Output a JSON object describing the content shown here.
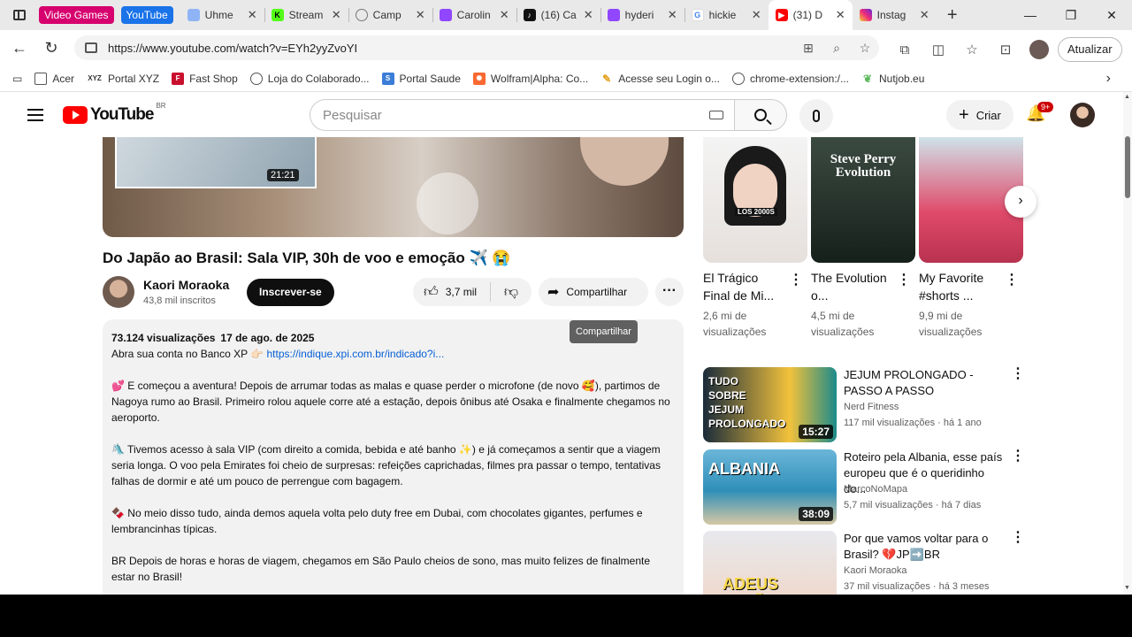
{
  "browser": {
    "tab_groups": [
      {
        "label": "Video Games",
        "color": "#d6006e"
      },
      {
        "label": "YouTube",
        "color": "#1a73e8"
      }
    ],
    "tabs": [
      {
        "label": "Uhme",
        "icon": "chat-icon",
        "color": "#8fb4f5"
      },
      {
        "label": "Stream",
        "icon": "kick-icon",
        "color": "#53fc18"
      },
      {
        "label": "Camp",
        "icon": "globe-icon",
        "color": "#999999"
      },
      {
        "label": "Carolin",
        "icon": "twitch-icon",
        "color": "#9146ff"
      },
      {
        "label": "(16) Ca",
        "icon": "tiktok-icon",
        "color": "#111111"
      },
      {
        "label": "hyderi",
        "icon": "twitch-icon",
        "color": "#9146ff"
      },
      {
        "label": "hickie",
        "icon": "google-icon",
        "color": "#4285f4"
      },
      {
        "label": "(31) D",
        "icon": "youtube-icon",
        "color": "#ff0000",
        "active": true
      },
      {
        "label": "Instag",
        "icon": "instagram-icon",
        "color": "#e1306c"
      }
    ],
    "url": "https://www.youtube.com/watch?v=EYh2yyZvoYI",
    "update_label": "Atualizar",
    "bookmarks": [
      {
        "label": "Acer",
        "icon": "folder-icon"
      },
      {
        "label": "Portal XYZ",
        "icon": "xyz-icon"
      },
      {
        "label": "Fast Shop",
        "icon": "fastshop-icon"
      },
      {
        "label": "Loja do Colaborado...",
        "icon": "globe-icon"
      },
      {
        "label": "Portal Saude",
        "icon": "portal-icon"
      },
      {
        "label": "Wolfram|Alpha: Co...",
        "icon": "wolfram-icon"
      },
      {
        "label": "Acesse seu Login o...",
        "icon": "pen-icon"
      },
      {
        "label": "chrome-extension:/...",
        "icon": "globe-icon"
      },
      {
        "label": "Nutjob.eu",
        "icon": "leaf-icon"
      }
    ]
  },
  "youtube": {
    "logo_text": "YouTube",
    "country_code": "BR",
    "search_placeholder": "Pesquisar",
    "create_label": "Criar",
    "notif_badge": "9+"
  },
  "video": {
    "duration_inset": "21:21",
    "title": "Do Japão ao Brasil: Sala VIP, 30h de voo e emoção ✈️ 😭",
    "channel": "Kaori Moraoka",
    "subscribers": "43,8 mil inscritos",
    "subscribe_label": "Inscrever-se",
    "likes": "3,7 mil",
    "share_label": "Compartilhar",
    "tooltip": "Compartilhar",
    "views": "73.124 visualizações",
    "date": "17 de ago. de 2025",
    "description": [
      {
        "text": "Abra sua conta no Banco XP  👉🏻 ",
        "link": "https://indique.xpi.com.br/indicado?i..."
      },
      {
        "text": "💕 E começou a aventura! Depois de arrumar todas as malas e quase perder o microfone (de novo 🥰), partimos de Nagoya rumo ao Brasil. Primeiro rolou aquele corre até a estação, depois ônibus até Osaka e finalmente chegamos no aeroporto."
      },
      {
        "text": "🛝 Tivemos acesso à sala VIP (com direito a comida, bebida e até banho ✨) e já começamos a sentir que a viagem seria longa. O voo pela Emirates foi cheio de surpresas: refeições caprichadas, filmes pra passar o tempo, tentativas falhas de dormir e até um pouco de perrengue com bagagem."
      },
      {
        "text": "🍫 No meio disso tudo, ainda demos aquela volta pelo duty free em Dubai, com chocolates gigantes, perfumes e lembrancinhas típicas."
      },
      {
        "text": "BR Depois de horas e horas de viagem, chegamos em São Paulo cheios de sono, mas muito felizes de finalmente estar no Brasil!"
      }
    ]
  },
  "shorts": [
    {
      "title": "El Trágico Final de Mi...",
      "views": "2,6 mi de visualizações",
      "thumb_text": "LOS 2000S"
    },
    {
      "title": "The Evolution o...",
      "views": "4,5 mi de visualizações",
      "thumb_text": "Steve Perry Evolution"
    },
    {
      "title": "My Favorite #shorts ...",
      "views": "9,9 mi de visualizações",
      "thumb_text": ""
    }
  ],
  "recommendations": [
    {
      "title": "JEJUM PROLONGADO - PASSO A PASSO",
      "channel": "Nerd Fitness",
      "meta": "117 mil visualizações · há 1 ano",
      "duration": "15:27",
      "thumb_text": "TUDO SOBRE JEJUM PROLONGADO"
    },
    {
      "title": "Roteiro pela Albania, esse país europeu que é o queridinho do...",
      "channel": "MarcoNoMapa",
      "meta": "5,7 mil visualizações · há 7 dias",
      "duration": "38:09",
      "thumb_text": "ALBANIA"
    },
    {
      "title": "Por que vamos voltar para o Brasil? 💔JP➡️BR",
      "channel": "Kaori Moraoka",
      "meta": "37 mil visualizações · há 3 meses",
      "duration": "",
      "thumb_text": "ADEUS JAPÃO"
    }
  ]
}
